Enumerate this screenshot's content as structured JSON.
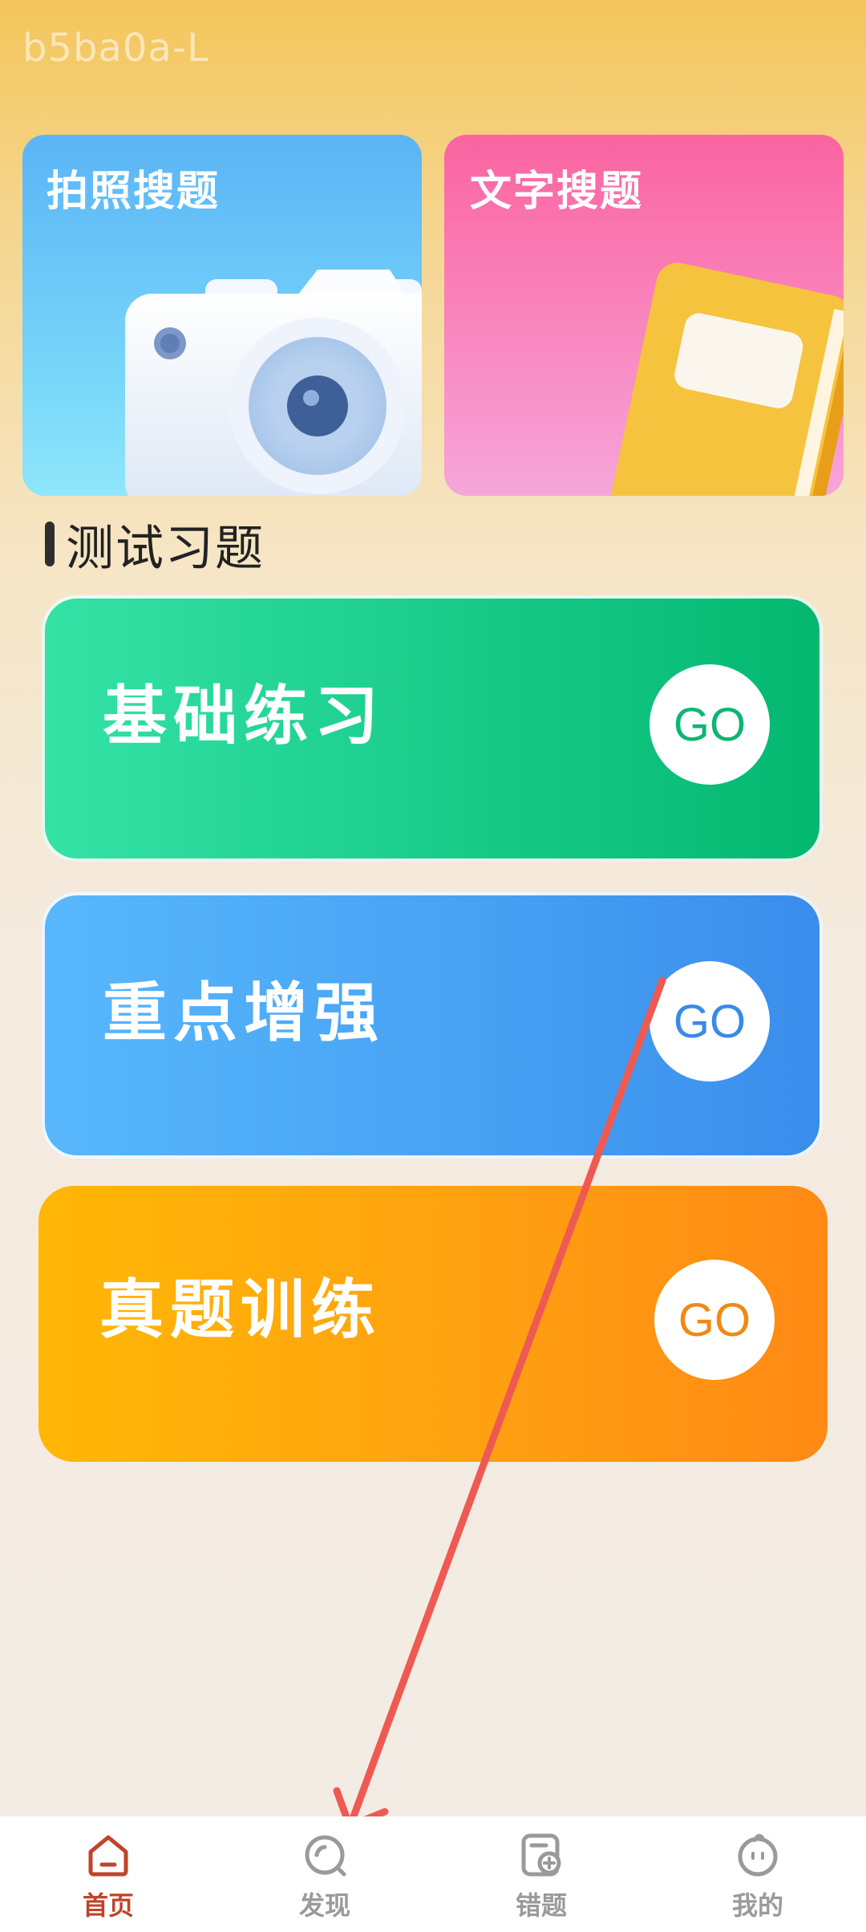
{
  "watermark": "b5ba0a-L",
  "top_cards": {
    "photo_search": {
      "label": "拍照搜题",
      "icon": "camera-icon"
    },
    "text_search": {
      "label": "文字搜题",
      "icon": "book-icon"
    }
  },
  "section": {
    "title": "测试习题"
  },
  "practice_cards": [
    {
      "label": "基础练习",
      "go": "GO",
      "color": "#16C886"
    },
    {
      "label": "重点增强",
      "go": "GO",
      "color": "#47A2F3"
    },
    {
      "label": "真题训练",
      "go": "GO",
      "color": "#FFA111"
    }
  ],
  "bottom_nav": [
    {
      "label": "首页",
      "icon": "home-icon",
      "active": true
    },
    {
      "label": "发现",
      "icon": "discover-icon",
      "active": false
    },
    {
      "label": "错题",
      "icon": "wrong-questions-icon",
      "active": false
    },
    {
      "label": "我的",
      "icon": "profile-icon",
      "active": false
    }
  ],
  "colors": {
    "accent": "#C0432A",
    "inactive": "#9A9A9A",
    "annotation_arrow": "#EE5A52"
  }
}
